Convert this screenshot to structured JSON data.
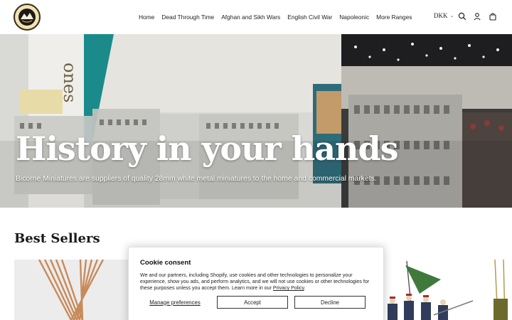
{
  "header": {
    "logo_alt": "Bicorne Miniatures",
    "nav": [
      "Home",
      "Dead Through Time",
      "Afghan and Sikh Wars",
      "English Civil War",
      "Napoleonic",
      "More Ranges"
    ],
    "currency": "DKK",
    "icons": [
      "search-icon",
      "account-icon",
      "cart-icon"
    ]
  },
  "hero": {
    "title": "History in your hands",
    "subtitle": "Bicorne Miniatures are suppliers of quality 28mm white metal miniatures to the home and commercial markets."
  },
  "best_sellers": {
    "title": "Best Sellers"
  },
  "cookie": {
    "title": "Cookie consent",
    "body": "We and our partners, including Shopify, use cookies and other technologies to personalize your experience, show you ads, and perform analytics, and we will not use cookies or other technologies for these purposes unless you accept them. Learn more in our",
    "link": "Privacy Policy",
    "manage": "Manage preferences",
    "accept": "Accept",
    "decline": "Decline"
  }
}
